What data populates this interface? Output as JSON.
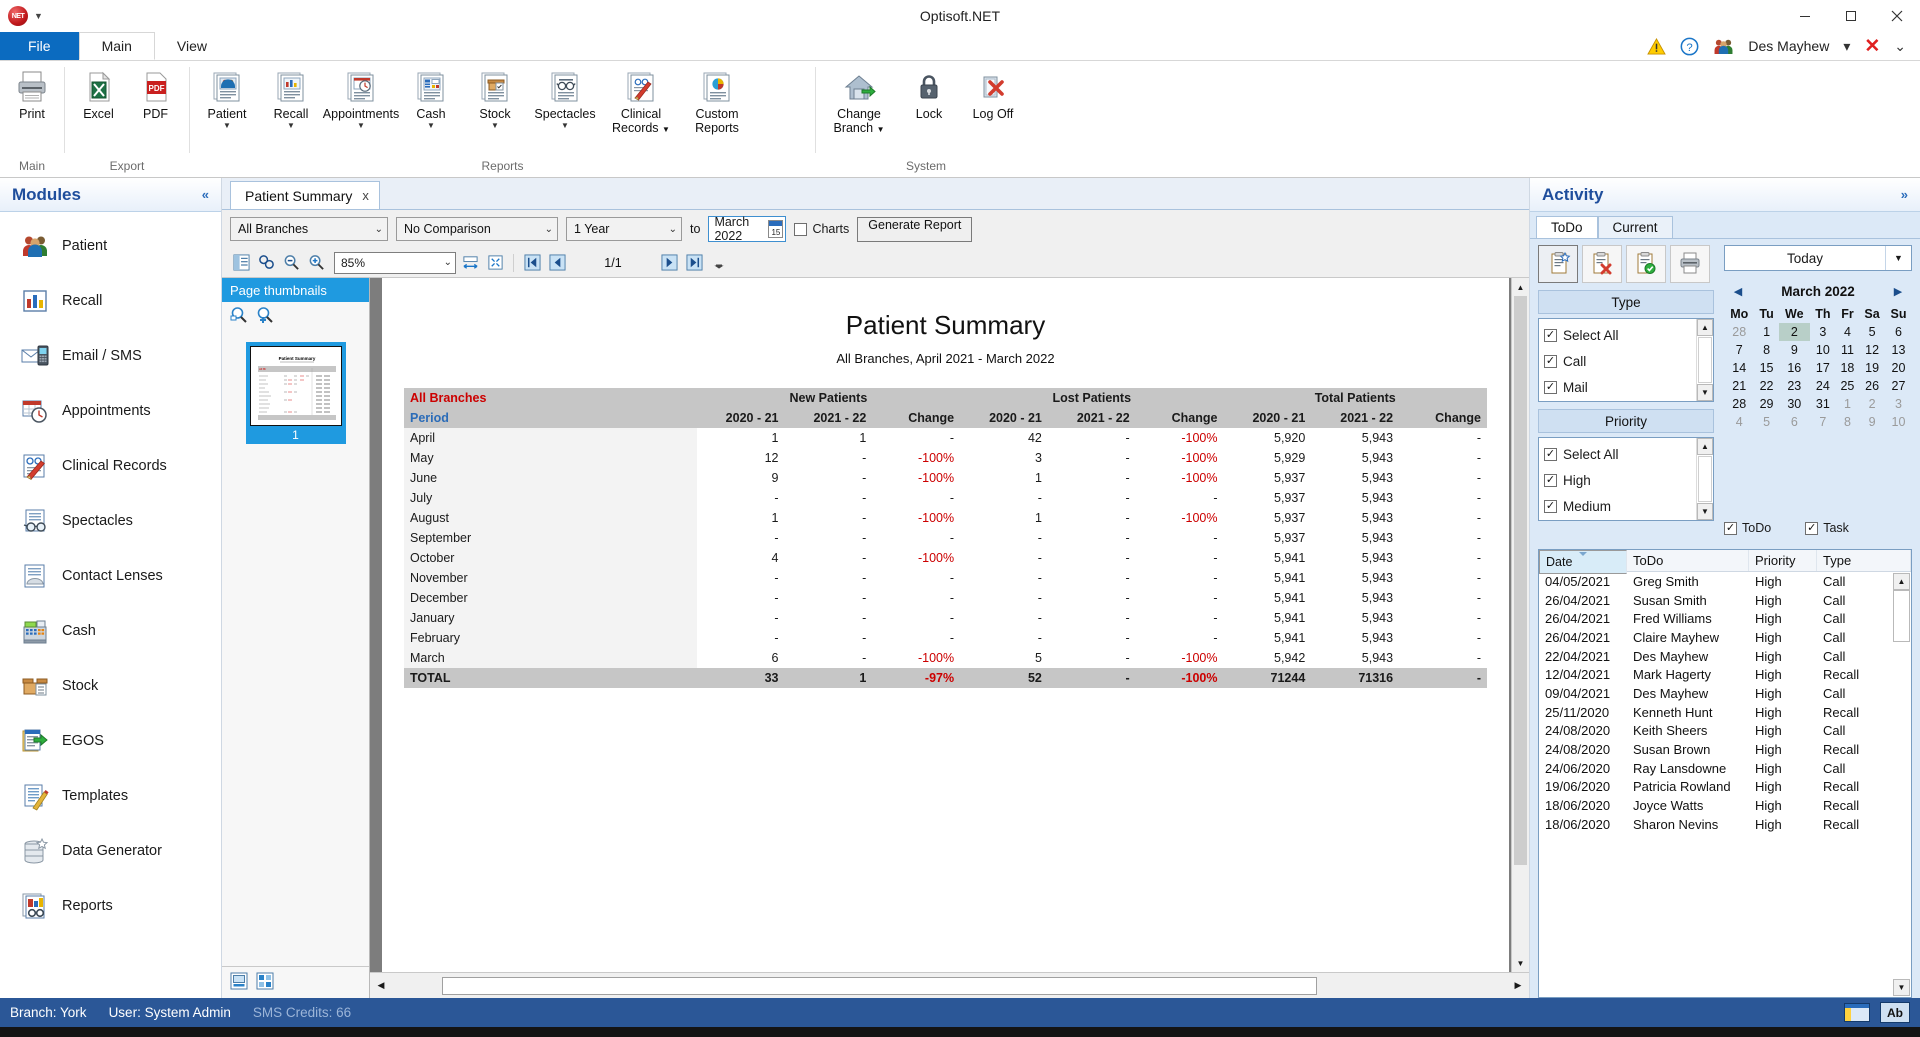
{
  "window": {
    "title": "Optisoft.NET",
    "minimize": "minimize-icon",
    "maximize": "maximize-icon",
    "close": "close-icon"
  },
  "ribbon": {
    "tabs": [
      {
        "label": "File"
      },
      {
        "label": "Main"
      },
      {
        "label": "View"
      }
    ],
    "active_tab": "Main",
    "right": {
      "warning_icon": "warning-icon",
      "help_icon": "help-icon",
      "user": "Des Mayhew",
      "close_label": "✕",
      "collapse_label": "⌄"
    },
    "groups": [
      {
        "label": "Main",
        "buttons": [
          {
            "label": "Print",
            "icon": "printer-icon",
            "caret": false
          }
        ]
      },
      {
        "label": "Export",
        "buttons": [
          {
            "label": "Excel",
            "icon": "excel-icon",
            "caret": false
          },
          {
            "label": "PDF",
            "icon": "pdf-icon",
            "caret": false
          }
        ]
      },
      {
        "label": "Reports",
        "buttons": [
          {
            "label": "Patient",
            "icon": "patient-report-icon",
            "caret": true
          },
          {
            "label": "Recall",
            "icon": "recall-report-icon",
            "caret": true
          },
          {
            "label": "Appointments",
            "icon": "appointments-report-icon",
            "caret": true
          },
          {
            "label": "Cash",
            "icon": "cash-report-icon",
            "caret": true
          },
          {
            "label": "Stock",
            "icon": "stock-report-icon",
            "caret": true
          },
          {
            "label": "Spectacles",
            "icon": "spectacles-report-icon",
            "caret": true
          },
          {
            "label": "Clinical Records",
            "icon": "clinical-records-report-icon",
            "caret": "inline"
          },
          {
            "label": "Custom Reports",
            "icon": "custom-reports-icon",
            "caret": false
          }
        ]
      },
      {
        "label": "System",
        "buttons": [
          {
            "label": "Change Branch",
            "icon": "home-branch-icon",
            "caret": "inline"
          },
          {
            "label": "Lock",
            "icon": "lock-icon",
            "caret": false
          },
          {
            "label": "Log Off",
            "icon": "logoff-icon",
            "caret": false
          }
        ]
      }
    ]
  },
  "modules": {
    "title": "Modules",
    "collapse": "«",
    "items": [
      {
        "label": "Patient",
        "icon": "patient-icon"
      },
      {
        "label": "Recall",
        "icon": "recall-chart-icon"
      },
      {
        "label": "Email / SMS",
        "icon": "email-sms-icon"
      },
      {
        "label": "Appointments",
        "icon": "appointments-icon"
      },
      {
        "label": "Clinical Records",
        "icon": "clinical-records-icon"
      },
      {
        "label": "Spectacles",
        "icon": "spectacles-icon"
      },
      {
        "label": "Contact Lenses",
        "icon": "contact-lenses-icon"
      },
      {
        "label": "Cash",
        "icon": "cash-register-icon"
      },
      {
        "label": "Stock",
        "icon": "stock-box-icon"
      },
      {
        "label": "EGOS",
        "icon": "egos-icon"
      },
      {
        "label": "Templates",
        "icon": "templates-icon"
      },
      {
        "label": "Data Generator",
        "icon": "data-generator-icon"
      },
      {
        "label": "Reports",
        "icon": "reports-icon"
      }
    ]
  },
  "document_tab": {
    "label": "Patient Summary",
    "close": "x"
  },
  "report_toolbar": {
    "branch": "All Branches",
    "comparison": "No Comparison",
    "period": "1 Year",
    "to_label": "to",
    "date": "March 2022",
    "charts_label": "Charts",
    "charts_checked": false,
    "generate_label": "Generate Report"
  },
  "viewer_toolbar": {
    "zoom": "85%",
    "page_position": "1/1",
    "icons": [
      "document-map-icon",
      "find-icon",
      "zoom-out-icon",
      "zoom-in-icon",
      "page-width-icon",
      "whole-page-icon",
      "first-page-icon",
      "previous-page-icon",
      "next-page-icon",
      "last-page-icon",
      "more-icon"
    ]
  },
  "thumbnails": {
    "title": "Page thumbnails",
    "zoom_out_icon": "thumb-zoom-out-icon",
    "zoom_in_icon": "thumb-zoom-in-icon",
    "page_number": "1",
    "foot_icons": [
      "thumbnail-view-icon",
      "page-view-icon"
    ]
  },
  "report": {
    "title": "Patient Summary",
    "subtitle": "All Branches, April 2021 - March 2022",
    "corner_label": "All Branches",
    "period_label": "Period",
    "group_headers": [
      "New Patients",
      "Lost Patients",
      "Total Patients"
    ],
    "sub_headers": [
      "2020 - 21",
      "2021 - 22",
      "Change"
    ],
    "rows": [
      {
        "period": "April",
        "new": [
          "1",
          "1",
          "-"
        ],
        "lost": [
          "42",
          "-",
          "-100%"
        ],
        "total": [
          "5,920",
          "5,943",
          "-"
        ]
      },
      {
        "period": "May",
        "new": [
          "12",
          "-",
          "-100%"
        ],
        "lost": [
          "3",
          "-",
          "-100%"
        ],
        "total": [
          "5,929",
          "5,943",
          "-"
        ]
      },
      {
        "period": "June",
        "new": [
          "9",
          "-",
          "-100%"
        ],
        "lost": [
          "1",
          "-",
          "-100%"
        ],
        "total": [
          "5,937",
          "5,943",
          "-"
        ]
      },
      {
        "period": "July",
        "new": [
          "-",
          "-",
          "-"
        ],
        "lost": [
          "-",
          "-",
          "-"
        ],
        "total": [
          "5,937",
          "5,943",
          "-"
        ]
      },
      {
        "period": "August",
        "new": [
          "1",
          "-",
          "-100%"
        ],
        "lost": [
          "1",
          "-",
          "-100%"
        ],
        "total": [
          "5,937",
          "5,943",
          "-"
        ]
      },
      {
        "period": "September",
        "new": [
          "-",
          "-",
          "-"
        ],
        "lost": [
          "-",
          "-",
          "-"
        ],
        "total": [
          "5,937",
          "5,943",
          "-"
        ]
      },
      {
        "period": "October",
        "new": [
          "4",
          "-",
          "-100%"
        ],
        "lost": [
          "-",
          "-",
          "-"
        ],
        "total": [
          "5,941",
          "5,943",
          "-"
        ]
      },
      {
        "period": "November",
        "new": [
          "-",
          "-",
          "-"
        ],
        "lost": [
          "-",
          "-",
          "-"
        ],
        "total": [
          "5,941",
          "5,943",
          "-"
        ]
      },
      {
        "period": "December",
        "new": [
          "-",
          "-",
          "-"
        ],
        "lost": [
          "-",
          "-",
          "-"
        ],
        "total": [
          "5,941",
          "5,943",
          "-"
        ]
      },
      {
        "period": "January",
        "new": [
          "-",
          "-",
          "-"
        ],
        "lost": [
          "-",
          "-",
          "-"
        ],
        "total": [
          "5,941",
          "5,943",
          "-"
        ]
      },
      {
        "period": "February",
        "new": [
          "-",
          "-",
          "-"
        ],
        "lost": [
          "-",
          "-",
          "-"
        ],
        "total": [
          "5,941",
          "5,943",
          "-"
        ]
      },
      {
        "period": "March",
        "new": [
          "6",
          "-",
          "-100%"
        ],
        "lost": [
          "5",
          "-",
          "-100%"
        ],
        "total": [
          "5,942",
          "5,943",
          "-"
        ]
      }
    ],
    "total_row": {
      "period": "TOTAL",
      "new": [
        "33",
        "1",
        "-97%"
      ],
      "lost": [
        "52",
        "-",
        "-100%"
      ],
      "total": [
        "71244",
        "71316",
        "-"
      ]
    }
  },
  "activity": {
    "title": "Activity",
    "expand": "»",
    "tabs": [
      {
        "label": "ToDo"
      },
      {
        "label": "Current"
      }
    ],
    "active_tab": "ToDo",
    "action_icons": [
      "new-todo-icon",
      "delete-todo-icon",
      "complete-todo-icon",
      "print-todo-icon"
    ],
    "type_header": "Type",
    "type_items": [
      {
        "label": "Select All",
        "checked": true
      },
      {
        "label": "Call",
        "checked": true
      },
      {
        "label": "Mail",
        "checked": true
      }
    ],
    "priority_header": "Priority",
    "priority_items": [
      {
        "label": "Select All",
        "checked": true
      },
      {
        "label": "High",
        "checked": true
      },
      {
        "label": "Medium",
        "checked": true
      }
    ],
    "today_label": "Today",
    "calendar": {
      "month": "March 2022",
      "prev": "◀",
      "next": "▶",
      "daynames": [
        "Mo",
        "Tu",
        "We",
        "Th",
        "Fr",
        "Sa",
        "Su"
      ],
      "weeks": [
        [
          {
            "d": "28",
            "mute": true
          },
          {
            "d": "1"
          },
          {
            "d": "2",
            "today": true
          },
          {
            "d": "3"
          },
          {
            "d": "4"
          },
          {
            "d": "5"
          },
          {
            "d": "6"
          }
        ],
        [
          {
            "d": "7"
          },
          {
            "d": "8"
          },
          {
            "d": "9"
          },
          {
            "d": "10"
          },
          {
            "d": "11"
          },
          {
            "d": "12"
          },
          {
            "d": "13"
          }
        ],
        [
          {
            "d": "14"
          },
          {
            "d": "15"
          },
          {
            "d": "16"
          },
          {
            "d": "17"
          },
          {
            "d": "18"
          },
          {
            "d": "19"
          },
          {
            "d": "20"
          }
        ],
        [
          {
            "d": "21"
          },
          {
            "d": "22"
          },
          {
            "d": "23"
          },
          {
            "d": "24"
          },
          {
            "d": "25"
          },
          {
            "d": "26"
          },
          {
            "d": "27"
          }
        ],
        [
          {
            "d": "28"
          },
          {
            "d": "29"
          },
          {
            "d": "30"
          },
          {
            "d": "31"
          },
          {
            "d": "1",
            "mute": true
          },
          {
            "d": "2",
            "mute": true
          },
          {
            "d": "3",
            "mute": true
          }
        ],
        [
          {
            "d": "4",
            "mute": true
          },
          {
            "d": "5",
            "mute": true
          },
          {
            "d": "6",
            "mute": true
          },
          {
            "d": "7",
            "mute": true
          },
          {
            "d": "8",
            "mute": true
          },
          {
            "d": "9",
            "mute": true
          },
          {
            "d": "10",
            "mute": true
          }
        ]
      ]
    },
    "todo_toggle": {
      "label": "ToDo",
      "checked": true
    },
    "task_toggle": {
      "label": "Task",
      "checked": true
    },
    "grid_columns": [
      "Date",
      "ToDo",
      "Priority",
      "Type"
    ],
    "grid_rows": [
      [
        "04/05/2021",
        "Greg Smith",
        "High",
        "Call"
      ],
      [
        "26/04/2021",
        "Susan Smith",
        "High",
        "Call"
      ],
      [
        "26/04/2021",
        "Fred Williams",
        "High",
        "Call"
      ],
      [
        "26/04/2021",
        "Claire Mayhew",
        "High",
        "Call"
      ],
      [
        "22/04/2021",
        "Des Mayhew",
        "High",
        "Call"
      ],
      [
        "12/04/2021",
        "Mark Hagerty",
        "High",
        "Recall"
      ],
      [
        "09/04/2021",
        "Des Mayhew",
        "High",
        "Call"
      ],
      [
        "25/11/2020",
        "Kenneth Hunt",
        "High",
        "Recall"
      ],
      [
        "24/08/2020",
        "Keith Sheers",
        "High",
        "Call"
      ],
      [
        "24/08/2020",
        "Susan Brown",
        "High",
        "Recall"
      ],
      [
        "24/06/2020",
        "Ray Lansdowne",
        "High",
        "Call"
      ],
      [
        "19/06/2020",
        "Patricia Rowland",
        "High",
        "Recall"
      ],
      [
        "18/06/2020",
        "Joyce Watts",
        "High",
        "Recall"
      ],
      [
        "18/06/2020",
        "Sharon Nevins",
        "High",
        "Recall"
      ]
    ]
  },
  "status": {
    "branch": "Branch: York",
    "user": "User: System Admin",
    "sms": "SMS Credits: 66",
    "right_icons": [
      "window-layout-icon",
      "ab-icon"
    ]
  },
  "colors": {
    "accent": "#0b6bc0",
    "panel_title": "#1f4e9c",
    "status_bg": "#2b5797",
    "negative": "#cc0000",
    "thumb_header": "#1f9ae0"
  }
}
